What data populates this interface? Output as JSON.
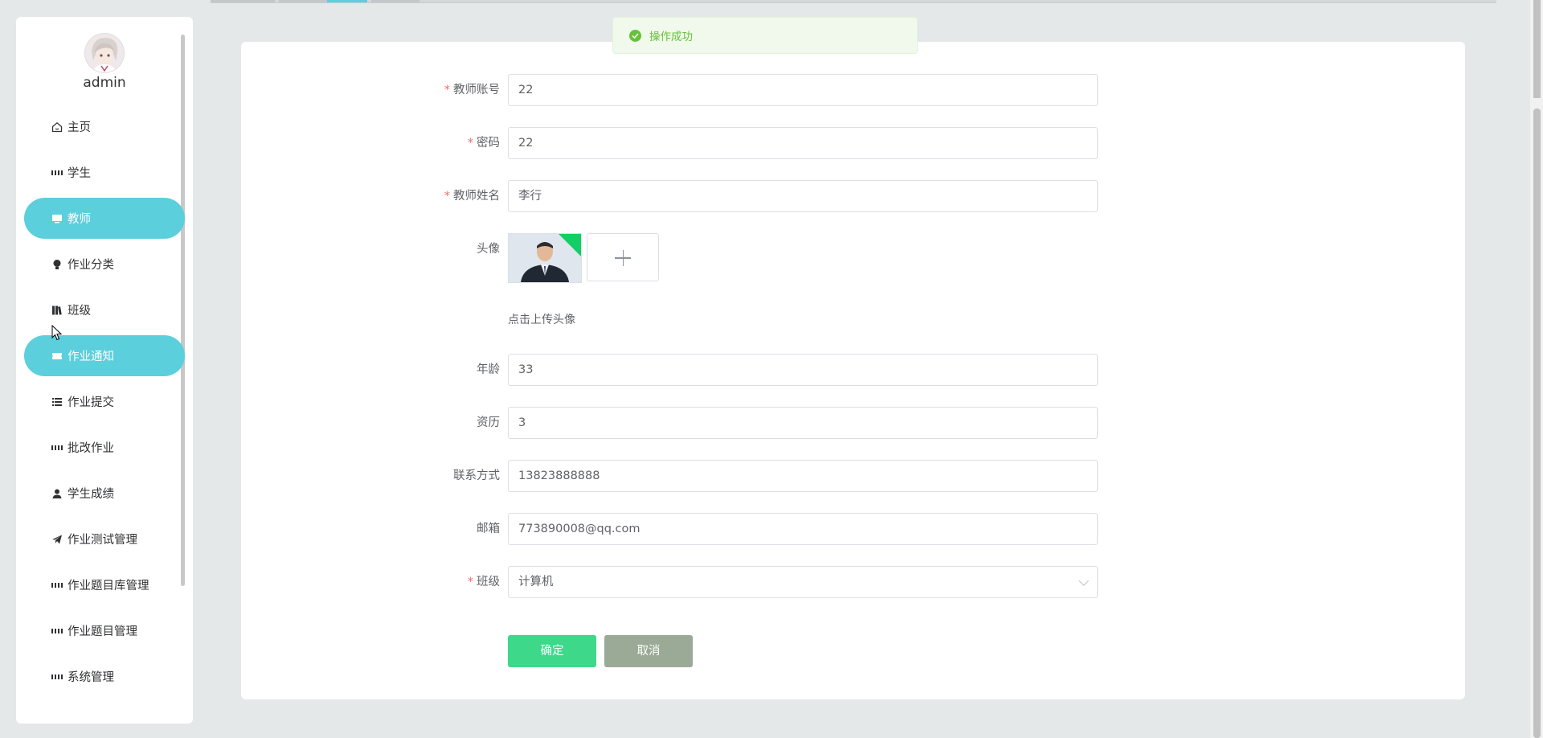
{
  "sidebar": {
    "username": "admin",
    "items": [
      {
        "label": "主页",
        "icon": "home-icon",
        "active": false
      },
      {
        "label": "学生",
        "icon": "grid-icon",
        "active": false
      },
      {
        "label": "教师",
        "icon": "monitor-icon",
        "active": true
      },
      {
        "label": "作业分类",
        "icon": "bulb-icon",
        "active": false
      },
      {
        "label": "班级",
        "icon": "books-icon",
        "active": false
      },
      {
        "label": "作业通知",
        "icon": "ticket-icon",
        "active": true
      },
      {
        "label": "作业提交",
        "icon": "list-icon",
        "active": false
      },
      {
        "label": "批改作业",
        "icon": "grid-icon",
        "active": false
      },
      {
        "label": "学生成绩",
        "icon": "user-icon",
        "active": false
      },
      {
        "label": "作业测试管理",
        "icon": "send-icon",
        "active": false
      },
      {
        "label": "作业题目库管理",
        "icon": "grid-icon",
        "active": false
      },
      {
        "label": "作业题目管理",
        "icon": "grid-icon",
        "active": false
      },
      {
        "label": "系统管理",
        "icon": "grid-icon",
        "active": false
      }
    ]
  },
  "toast": {
    "message": "操作成功",
    "color": "#67c23a"
  },
  "form": {
    "account": {
      "label": "教师账号",
      "value": "22",
      "required": true
    },
    "password": {
      "label": "密码",
      "value": "22",
      "required": true
    },
    "name": {
      "label": "教师姓名",
      "value": "李行",
      "required": true
    },
    "avatar": {
      "label": "头像",
      "hint": "点击上传头像"
    },
    "age": {
      "label": "年龄",
      "value": "33"
    },
    "experience": {
      "label": "资历",
      "value": "3"
    },
    "phone": {
      "label": "联系方式",
      "value": "13823888888"
    },
    "email": {
      "label": "邮箱",
      "value": "773890008@qq.com"
    },
    "class": {
      "label": "班级",
      "value": "计算机",
      "required": true
    }
  },
  "buttons": {
    "confirm": "确定",
    "cancel": "取消"
  },
  "colors": {
    "accent": "#5bcfdc",
    "confirm": "#3dd88a",
    "cancel": "#9aaa96",
    "required": "#f56c6c"
  }
}
